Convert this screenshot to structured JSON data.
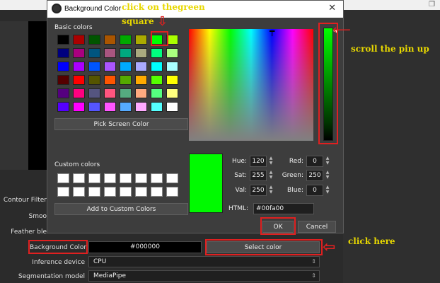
{
  "dialog": {
    "title": "Background Color",
    "basic_colors_label": "Basic colors",
    "custom_colors_label": "Custom colors",
    "pick_screen_label": "Pick Screen Color",
    "add_custom_label": "Add to Custom Colors",
    "ok_label": "OK",
    "cancel_label": "Cancel",
    "preview_color": "#00fa00",
    "hue": {
      "label": "Hue:",
      "value": "120"
    },
    "sat": {
      "label": "Sat:",
      "value": "255"
    },
    "val": {
      "label": "Val:",
      "value": "250"
    },
    "red": {
      "label": "Red:",
      "value": "0"
    },
    "green": {
      "label": "Green:",
      "value": "250"
    },
    "blue": {
      "label": "Blue:",
      "value": "0"
    },
    "html": {
      "label": "HTML:",
      "value": "#00fa00"
    },
    "basic_colors": [
      [
        "#000000",
        "#aa0000",
        "#005500",
        "#aa5500",
        "#00aa00",
        "#aaaa00",
        "#00ff00",
        "#aaff00"
      ],
      [
        "#00007f",
        "#aa007f",
        "#00557f",
        "#aa557f",
        "#00aa7f",
        "#aaaa7f",
        "#00ff7f",
        "#aaff7f"
      ],
      [
        "#0000ff",
        "#aa00ff",
        "#0055ff",
        "#aa55ff",
        "#00aaff",
        "#aaaaff",
        "#00ffff",
        "#aaffff"
      ],
      [
        "#550000",
        "#ff0000",
        "#555500",
        "#ff5500",
        "#55aa00",
        "#ffaa00",
        "#55ff00",
        "#ffff00"
      ],
      [
        "#55007f",
        "#ff007f",
        "#55557f",
        "#ff557f",
        "#55aa7f",
        "#ffaa7f",
        "#55ff7f",
        "#ffff7f"
      ],
      [
        "#5500ff",
        "#ff00ff",
        "#5555ff",
        "#ff55ff",
        "#55aaff",
        "#ffaaff",
        "#55ffff",
        "#ffffff"
      ]
    ]
  },
  "obs": {
    "contour_filter_label": "Contour Filter",
    "smooth_label": "Smoo",
    "feather_label": "Feather ble",
    "background_color_label": "Background Color",
    "background_color_value": "#000000",
    "select_color_label": "Select color",
    "inference_device_label": "Inference device",
    "inference_device_value": "CPU",
    "segmentation_model_label": "Segmentation model",
    "segmentation_model_value": "MediaPipe"
  },
  "annotations": {
    "click_green": "click on thegreen",
    "square": "square",
    "scroll_pin": "scroll the pin up",
    "click_here": "click here"
  }
}
